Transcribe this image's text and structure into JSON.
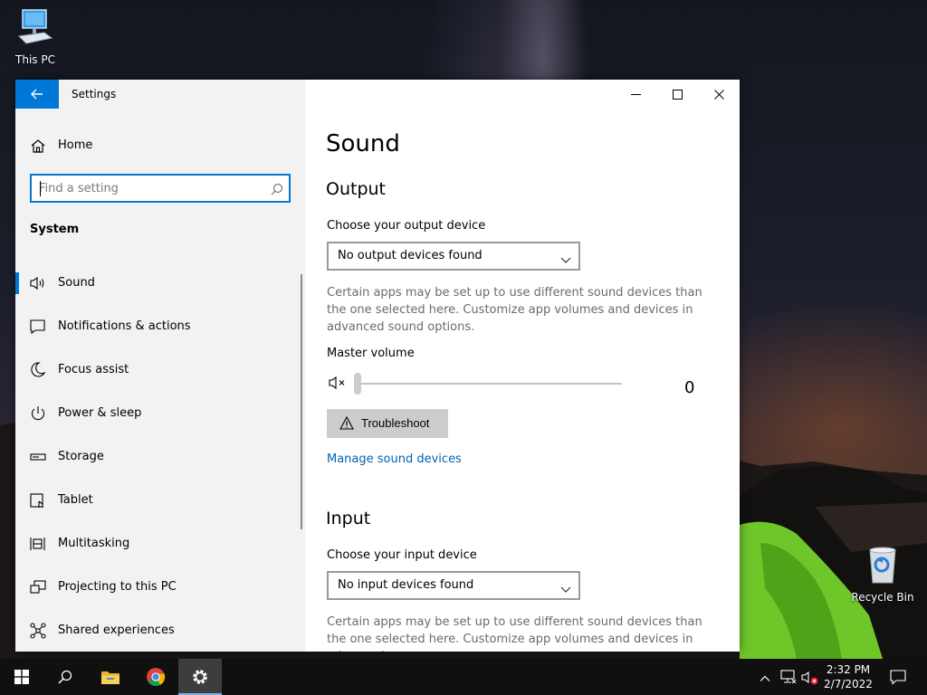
{
  "desktop": {
    "icons": [
      {
        "label": "This PC",
        "icon": "computer-icon"
      },
      {
        "label": "Recycle Bin",
        "icon": "recycle-bin-icon"
      }
    ]
  },
  "window": {
    "title": "Settings",
    "back_icon": "back-arrow-icon",
    "caption": {
      "minimize": "minimize-icon",
      "maximize": "maximize-icon",
      "close": "close-icon"
    }
  },
  "sidebar": {
    "home_label": "Home",
    "search_placeholder": "Find a setting",
    "section_title": "System",
    "items": [
      {
        "label": "Sound",
        "icon": "speaker-icon",
        "selected": true
      },
      {
        "label": "Notifications & actions",
        "icon": "notification-icon"
      },
      {
        "label": "Focus assist",
        "icon": "moon-icon"
      },
      {
        "label": "Power & sleep",
        "icon": "power-icon"
      },
      {
        "label": "Storage",
        "icon": "storage-icon"
      },
      {
        "label": "Tablet",
        "icon": "tablet-icon"
      },
      {
        "label": "Multitasking",
        "icon": "multitasking-icon"
      },
      {
        "label": "Projecting to this PC",
        "icon": "projecting-icon"
      },
      {
        "label": "Shared experiences",
        "icon": "shared-experiences-icon"
      }
    ]
  },
  "content": {
    "page_title": "Sound",
    "output": {
      "heading": "Output",
      "device_label": "Choose your output device",
      "device_value": "No output devices found",
      "description": "Certain apps may be set up to use different sound devices than the one selected here. Customize app volumes and devices in advanced sound options.",
      "volume_label": "Master volume",
      "volume_value": "0",
      "volume_level": 0,
      "troubleshoot_label": "Troubleshoot",
      "manage_link": "Manage sound devices"
    },
    "input": {
      "heading": "Input",
      "device_label": "Choose your input device",
      "device_value": "No input devices found",
      "description": "Certain apps may be set up to use different sound devices than the one selected here. Customize app volumes and devices in advanced"
    }
  },
  "taskbar": {
    "apps": [
      "start-icon",
      "search-icon",
      "file-explorer-icon",
      "chrome-icon",
      "settings-icon"
    ],
    "tray": [
      "chevron-up-icon",
      "network-icon",
      "volume-muted-icon",
      "action-center-icon"
    ],
    "time": "2:32 PM",
    "date": "2/7/2022"
  },
  "colors": {
    "accent": "#0078d7",
    "link": "#0063b1",
    "sidebar_bg": "#f2f2f2",
    "taskbar": "#101010"
  }
}
